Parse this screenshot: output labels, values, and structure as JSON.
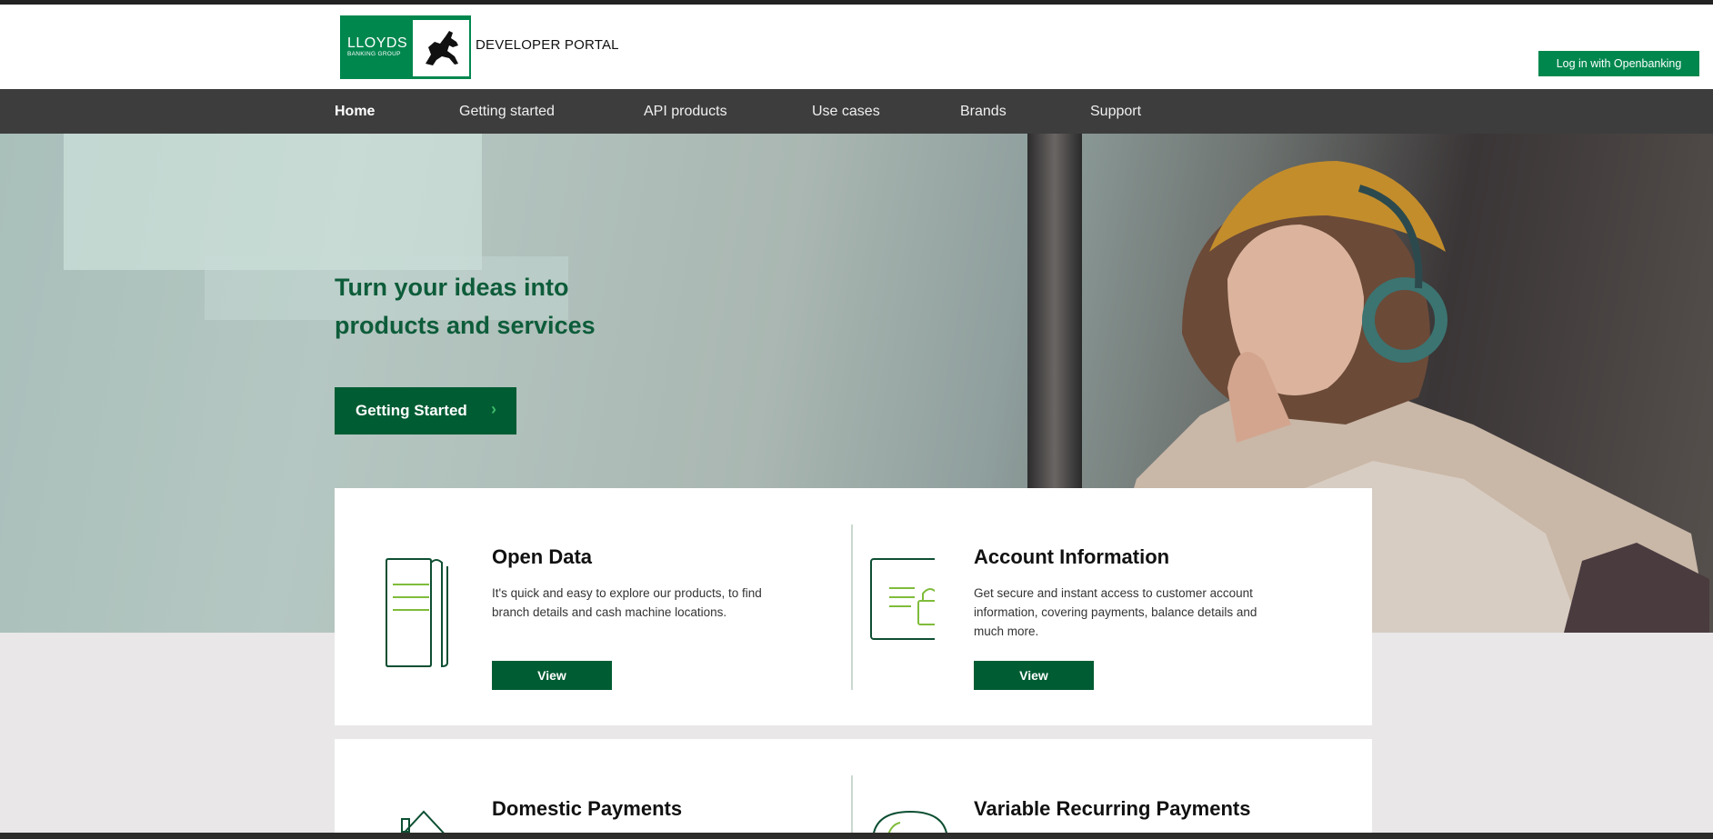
{
  "header": {
    "brand_main": "LLOYDS",
    "brand_sub": "BANKING GROUP",
    "portal_label": "DEVELOPER PORTAL",
    "login_label": "Log in with Openbanking",
    "brand_color": "#00874e"
  },
  "nav": {
    "items": [
      {
        "label": "Home",
        "active": true
      },
      {
        "label": "Getting started"
      },
      {
        "label": "API products"
      },
      {
        "label": "Use cases"
      },
      {
        "label": "Brands"
      },
      {
        "label": "Support"
      }
    ]
  },
  "hero": {
    "title_line1": "Turn your ideas into",
    "title_line2": "products and services",
    "cta_label": "Getting Started",
    "cta_icon": "chevron-right-icon"
  },
  "cards": [
    {
      "title": "Open Data",
      "description": "It's quick and easy to explore our products, to find branch details and cash machine locations.",
      "button_label": "View",
      "icon": "open-data-icon"
    },
    {
      "title": "Account Information",
      "description": "Get secure and instant access to customer account information, covering payments, balance details and much more.",
      "button_label": "View",
      "icon": "account-information-icon"
    },
    {
      "title": "Domestic Payments",
      "icon": "house-icon"
    },
    {
      "title": "Variable Recurring Payments",
      "icon": "clock-icon"
    }
  ],
  "colors": {
    "primary_dark": "#005c33",
    "nav_bg": "#3d3d3d",
    "headline": "#0d5c3a",
    "page_bg": "#e9e7e8"
  }
}
